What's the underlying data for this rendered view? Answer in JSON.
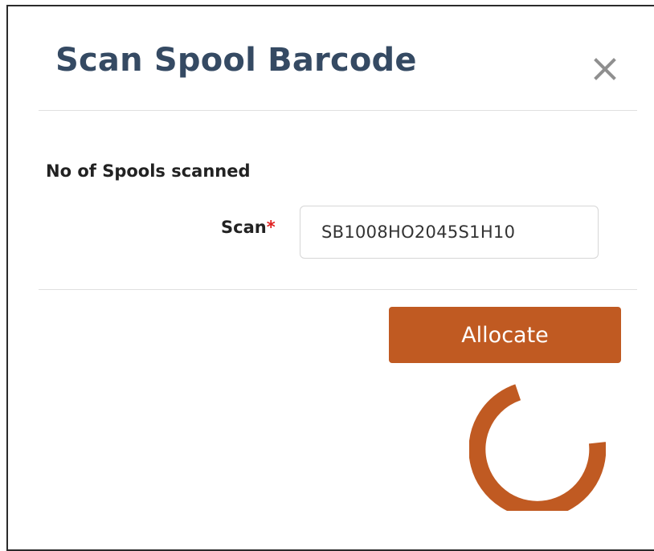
{
  "dialog": {
    "title": "Scan Spool Barcode",
    "close_icon": "close-icon"
  },
  "form": {
    "spools_scanned_label": "No of Spools scanned",
    "scan_label": "Scan",
    "required_marker": "*",
    "scan_value": "SB1008HO2045S1H10"
  },
  "actions": {
    "allocate_label": "Allocate"
  },
  "loader": {
    "icon": "loading-spinner-icon"
  },
  "colors": {
    "title": "#354a63",
    "accent": "#c05a22",
    "required": "#e02020"
  }
}
